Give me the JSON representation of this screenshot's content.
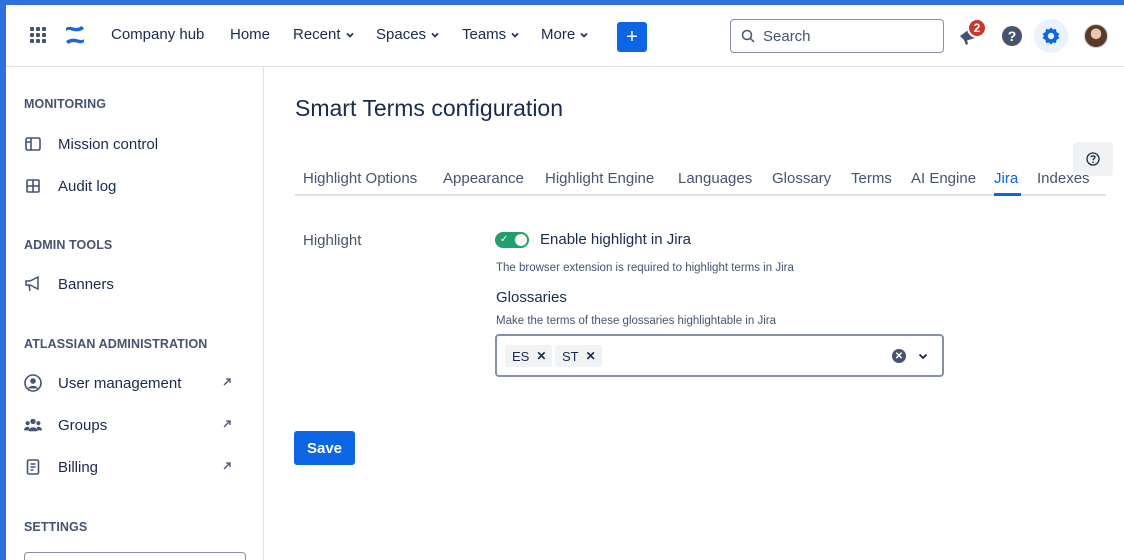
{
  "topbar": {
    "nav": [
      {
        "label": "Company hub",
        "dropdown": false
      },
      {
        "label": "Home",
        "dropdown": false
      },
      {
        "label": "Recent",
        "dropdown": true
      },
      {
        "label": "Spaces",
        "dropdown": true
      },
      {
        "label": "Teams",
        "dropdown": true
      },
      {
        "label": "More",
        "dropdown": true
      }
    ],
    "create_label": "+",
    "search_placeholder": "Search",
    "notification_count": "2",
    "help_label": "?",
    "accent_color": "#0c66e4"
  },
  "sidebar": {
    "sections": [
      {
        "heading": "MONITORING",
        "items": [
          {
            "label": "Mission control",
            "icon": "panel-icon",
            "external": false
          },
          {
            "label": "Audit log",
            "icon": "grid-icon",
            "external": false
          }
        ]
      },
      {
        "heading": "ADMIN TOOLS",
        "items": [
          {
            "label": "Banners",
            "icon": "megaphone-icon",
            "external": false
          }
        ]
      },
      {
        "heading": "ATLASSIAN ADMINISTRATION",
        "items": [
          {
            "label": "User management",
            "icon": "user-circle-icon",
            "external": true
          },
          {
            "label": "Groups",
            "icon": "people-icon",
            "external": true
          },
          {
            "label": "Billing",
            "icon": "receipt-icon",
            "external": true
          }
        ]
      },
      {
        "heading": "SETTINGS",
        "items": []
      }
    ]
  },
  "main": {
    "title": "Smart Terms configuration",
    "tabs": [
      {
        "label": "Highlight Options",
        "active": false
      },
      {
        "label": "Appearance",
        "active": false
      },
      {
        "label": "Highlight Engine",
        "active": false
      },
      {
        "label": "Languages",
        "active": false
      },
      {
        "label": "Glossary",
        "active": false
      },
      {
        "label": "Terms",
        "active": false
      },
      {
        "label": "AI Engine",
        "active": false
      },
      {
        "label": "Jira",
        "active": true
      },
      {
        "label": "Indexes",
        "active": false
      }
    ],
    "highlight_label": "Highlight",
    "toggle": {
      "label": "Enable highlight in Jira",
      "enabled": true,
      "color": "#22a06b"
    },
    "toggle_help": "The browser extension is required to highlight terms in Jira",
    "glossaries_label": "Glossaries",
    "glossaries_help": "Make the terms of these glossaries highlightable in Jira",
    "selected_glossaries": [
      "ES",
      "ST"
    ],
    "save_label": "Save"
  }
}
